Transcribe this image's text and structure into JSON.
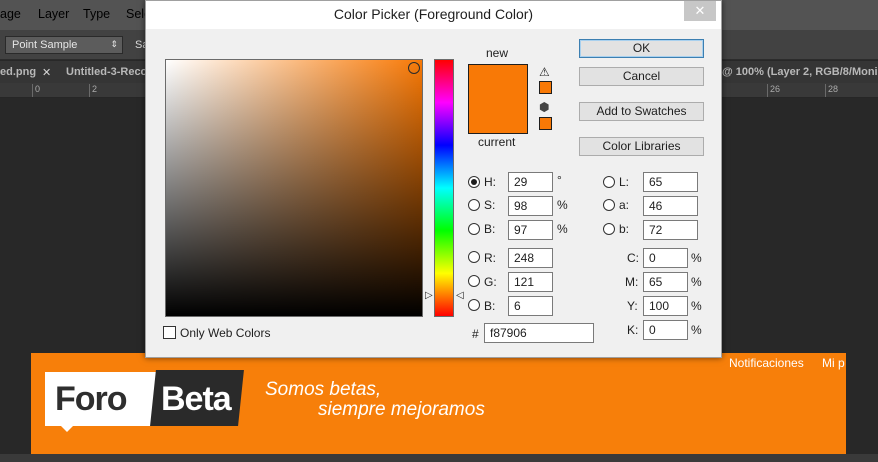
{
  "menubar": {
    "items": [
      "age",
      "Layer",
      "Type",
      "Sele"
    ]
  },
  "options": {
    "sample_select": "Point Sample",
    "sample_size_label": "Sa"
  },
  "tabs": {
    "tab1": "ed.png",
    "tab2": "Untitled-3-Reco",
    "tab3": "@ 100% (Layer 2, RGB/8/Moni"
  },
  "ruler": {
    "marks": [
      "0",
      "2",
      "26",
      "28"
    ]
  },
  "dialog": {
    "title": "Color Picker (Foreground Color)",
    "close_icon": "✕",
    "new_label": "new",
    "current_label": "current",
    "buttons": {
      "ok": "OK",
      "cancel": "Cancel",
      "add_swatches": "Add to Swatches",
      "color_libraries": "Color Libraries"
    },
    "hsb": {
      "h_label": "H:",
      "h_value": "29",
      "h_unit": "°",
      "s_label": "S:",
      "s_value": "98",
      "s_unit": "%",
      "b_label": "B:",
      "b_value": "97",
      "b_unit": "%"
    },
    "rgb": {
      "r_label": "R:",
      "r_value": "248",
      "g_label": "G:",
      "g_value": "121",
      "b_label": "B:",
      "b_value": "6"
    },
    "lab": {
      "l_label": "L:",
      "l_value": "65",
      "a_label": "a:",
      "a_value": "46",
      "b_label": "b:",
      "b_value": "72"
    },
    "cmyk": {
      "c_label": "C:",
      "c_value": "0",
      "c_unit": "%",
      "m_label": "M:",
      "m_value": "65",
      "m_unit": "%",
      "y_label": "Y:",
      "y_value": "100",
      "y_unit": "%",
      "k_label": "K:",
      "k_value": "0",
      "k_unit": "%"
    },
    "hex_label": "#",
    "hex_value": "f87906",
    "only_web_colors": "Only Web Colors",
    "colors": {
      "new": "#f87906",
      "current": "#f87906"
    }
  },
  "banner": {
    "nav": [
      "Notificaciones",
      "Mi p"
    ],
    "logo_left": "Foro",
    "logo_right": "Beta",
    "slogan_line1": "Somos betas,",
    "slogan_line2": "siempre mejoramos",
    "color": "#f77f0a"
  }
}
